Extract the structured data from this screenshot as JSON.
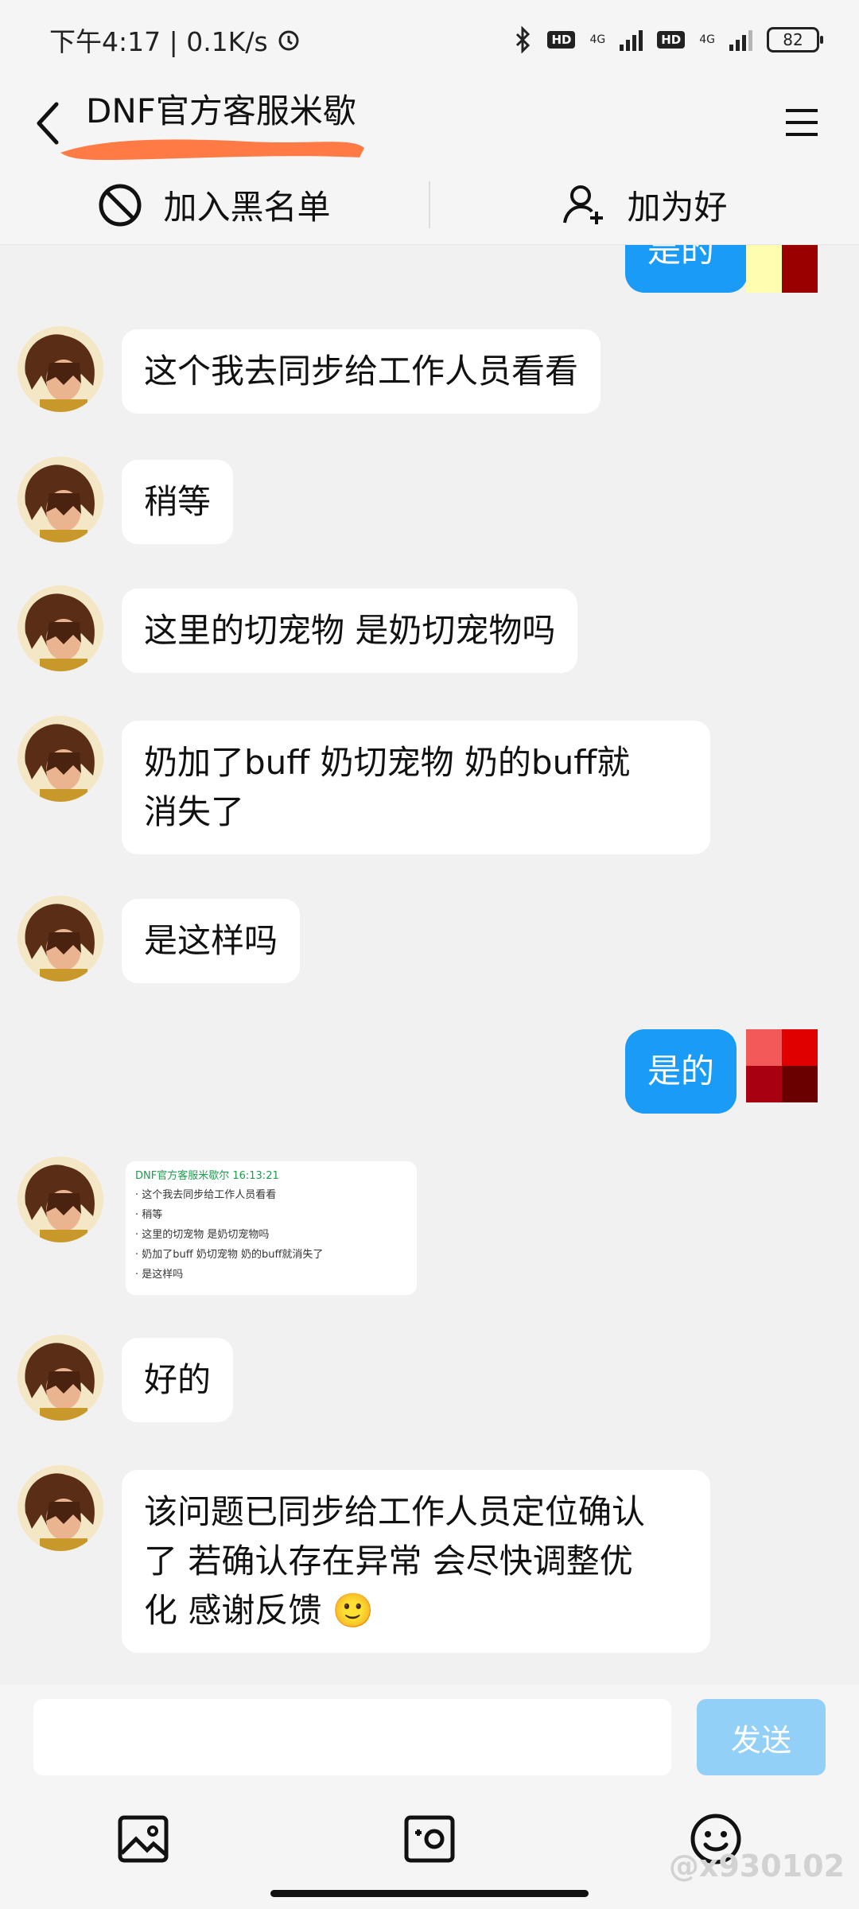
{
  "status_bar": {
    "time": "下午4:17 | 0.1K/s",
    "hd_label": "HD",
    "net_label": "4G",
    "battery": "82"
  },
  "header": {
    "title": "DNF官方客服米歇"
  },
  "actions": {
    "blacklist_label": "加入黑名单",
    "add_friend_label": "加为好"
  },
  "messages": [
    {
      "from": "me",
      "text": "是的"
    },
    {
      "from": "agent",
      "text": "这个我去同步给工作人员看看"
    },
    {
      "from": "agent",
      "text": "稍等"
    },
    {
      "from": "agent",
      "text": "这里的切宠物 是奶切宠物吗"
    },
    {
      "from": "agent",
      "text_line1": "奶加了buff 奶切宠物 奶的buff就",
      "text_line2": "消失了"
    },
    {
      "from": "agent",
      "text": "是这样吗"
    },
    {
      "from": "me",
      "text": "是的"
    },
    {
      "from": "agent",
      "type": "image",
      "shot_title": "DNF官方客服米歇尔  16:13:21",
      "shot_lines": [
        "这个我去同步给工作人员看看",
        "稍等",
        "这里的切宠物 是奶切宠物吗",
        "奶加了buff 奶切宠物 奶的buff就消失了",
        "是这样吗"
      ]
    },
    {
      "from": "agent",
      "text": "好的"
    },
    {
      "from": "agent",
      "text_line1": "该问题已同步给工作人员定位确认",
      "text_line2": "了 若确认存在异常 会尽快调整优",
      "text_line3": "化 感谢反馈 🙂"
    }
  ],
  "input": {
    "send_label": "发送"
  },
  "watermark": "@x930102",
  "colors": {
    "bubble_out": "#1a9cf6",
    "send_disabled": "#92d0f8",
    "scribble": "#ff7a45"
  }
}
